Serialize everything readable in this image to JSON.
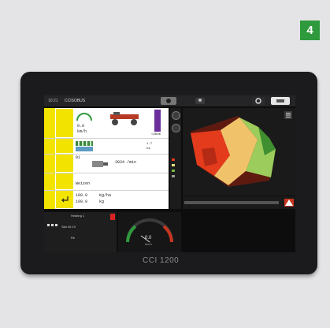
{
  "badge": "4",
  "device_brand": "CCI 1200",
  "screen": {
    "time": "10:21",
    "app_title": "CCISOBUS",
    "top_icons": [
      "user-icon",
      "settings-icon",
      "screen-toggle-icon",
      "menu-icon"
    ],
    "left_labels": [
      "",
      "",
      "",
      "",
      "",
      "",
      ""
    ],
    "rows": {
      "r1_a": "0.0",
      "r1_b": "km/h",
      "r1_c": "1.7",
      "r1_d": "ha",
      "r1_e": "<30cm",
      "r2_a": "01",
      "r2_b": "3034 /min",
      "r3_a": "Weizen",
      "r4_a": "100.0",
      "r4_b": "Kg/ha",
      "r4_c": "100.0",
      "r4_d": "kg"
    },
    "bottom_left": {
      "line1": "Heating 1",
      "line2": "Sila 00:19",
      "line3": "Re"
    },
    "gauge_value": "0.0",
    "gauge_unit": "km/h"
  },
  "colors": {
    "screen_bg": "#0d0d0e",
    "yellow": "#f2e400",
    "badge_green": "#2f9a3d",
    "map_red": "#e43b1c",
    "map_yellow": "#e9e07a",
    "map_green": "#78b742"
  }
}
